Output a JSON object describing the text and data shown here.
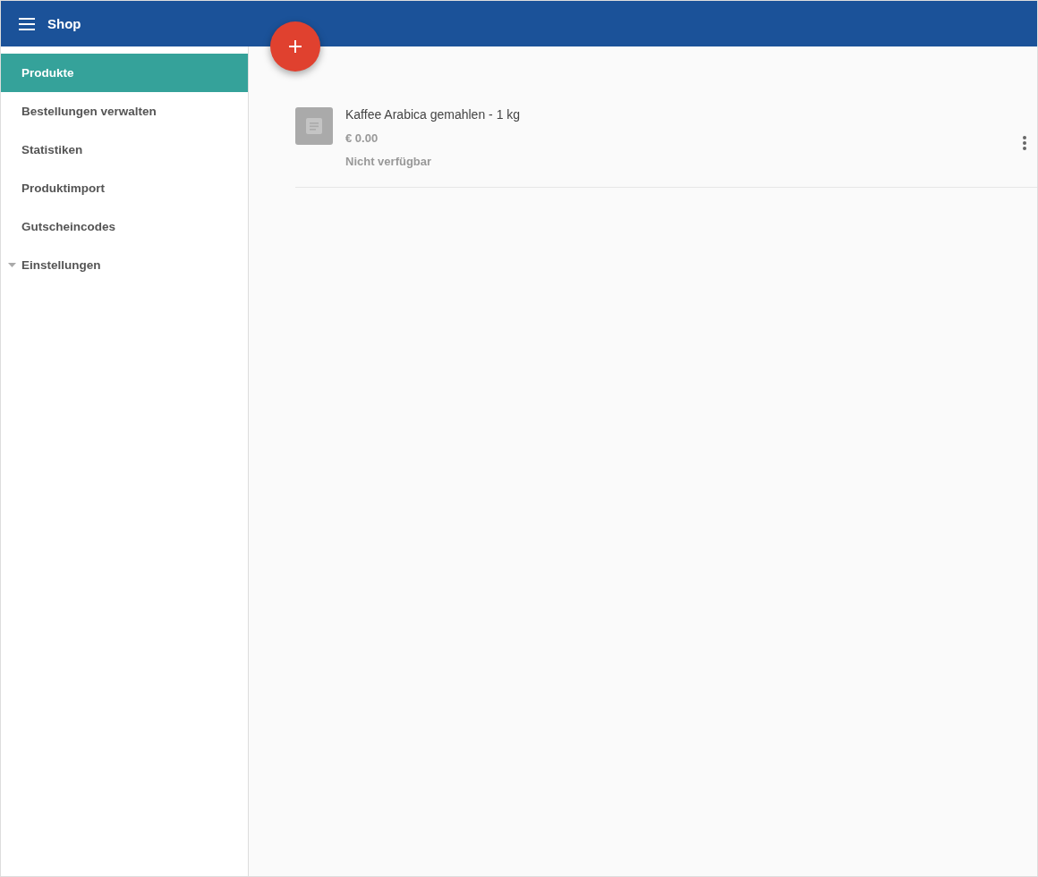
{
  "header": {
    "title": "Shop"
  },
  "sidebar": {
    "items": [
      {
        "label": "Produkte",
        "selected": true,
        "kind": "link"
      },
      {
        "label": "Bestellungen verwalten",
        "selected": false,
        "kind": "link"
      },
      {
        "label": "Statistiken",
        "selected": false,
        "kind": "link"
      },
      {
        "label": "Produktimport",
        "selected": false,
        "kind": "link"
      },
      {
        "label": "Gutscheincodes",
        "selected": false,
        "kind": "link"
      },
      {
        "label": "Einstellungen",
        "selected": false,
        "kind": "group"
      }
    ]
  },
  "products": [
    {
      "name": "Kaffee Arabica gemahlen - 1 kg",
      "price": "€ 0.00",
      "status": "Nicht verfügbar"
    }
  ]
}
